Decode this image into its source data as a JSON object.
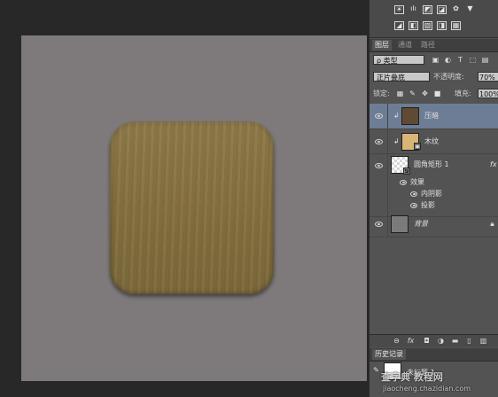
{
  "canvas": {
    "background_color": "#7e7a7b",
    "tile_color": "#86713f"
  },
  "top_tools": {
    "icons": [
      "brightness-icon",
      "levels-icon",
      "curves-icon",
      "exposure-icon",
      "vibrance-icon",
      "hue-icon",
      "color-balance-icon",
      "bw-icon",
      "photo-filter-icon",
      "channel-mixer-icon",
      "color-lookup-icon"
    ]
  },
  "tabs": [
    {
      "label": "图层",
      "active": true
    },
    {
      "label": "通道",
      "active": false
    },
    {
      "label": "路径",
      "active": false
    }
  ],
  "filter": {
    "kind_label": "ρ 类型"
  },
  "blend": {
    "mode": "正片叠底",
    "opacity_label": "不透明度:",
    "opacity_value": "70%"
  },
  "lock": {
    "label": "锁定:",
    "fill_label": "填充:",
    "fill_value": "100%"
  },
  "layers": [
    {
      "name": "压暗",
      "selected": true,
      "clipped": true,
      "thumb_color": "#5f4b34"
    },
    {
      "name": "木纹",
      "selected": false,
      "clipped": true,
      "thumb_color": "#d9b577"
    },
    {
      "name": "圆角矩形 1",
      "selected": false,
      "clipped": false,
      "thumb_color": "#ffffff",
      "fx": "fx"
    },
    {
      "name": "背景",
      "selected": false,
      "clipped": false,
      "thumb_color": "#7e7a7b"
    }
  ],
  "effects": {
    "group_label": "效果",
    "items": [
      "内阴影",
      "投影"
    ]
  },
  "history": {
    "title": "历史记录",
    "item": "未标题-1"
  },
  "watermark": {
    "text": "查字典 教程网",
    "url": "jiaocheng.chazidian.com"
  }
}
